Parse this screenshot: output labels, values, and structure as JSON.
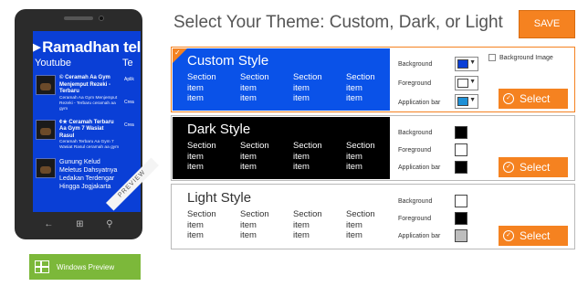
{
  "heading": "Select Your Theme: Custom, Dark, or Light",
  "save_label": "SAVE",
  "preview": {
    "title": "Ramadhan telah",
    "subtitle": "Youtube",
    "subtitle2": "Te",
    "feed": [
      {
        "title": "© Ceramah Aa Gym Menjemput Rezeki - Terbaru",
        "snippet": "Ceramah Aa Gym Menjemput Rezeki - Terbaru ceramah aa gym"
      },
      {
        "title": "¢★ Ceramah Terbaru Aa Gym 7 Wasiat Rasul",
        "snippet": "Ceramah Terbaru Aa Gym 7 Wasiat Rasul ceramah aa gym"
      },
      {
        "title": "Gunung Kelud Meletus Dahsyatnya Ledakan Terdengar Hingga Jogjakarta",
        "snippet": ""
      }
    ],
    "side_col": [
      "Aplik",
      "Crea",
      "Crea"
    ],
    "ribbon": "PREVIEW"
  },
  "windows_preview_label": "Windows Preview",
  "themes": [
    {
      "name": "Custom Style",
      "selected": true,
      "bg_color": "#0a52e8",
      "text_color": "#ffffff",
      "sections": [
        [
          "Section",
          "item",
          "item"
        ],
        [
          "Section",
          "item",
          "item"
        ],
        [
          "Section",
          "item",
          "item"
        ],
        [
          "Section",
          "item",
          "item"
        ]
      ],
      "props": [
        {
          "label": "Background",
          "color": "#0a3fd6"
        },
        {
          "label": "Foreground",
          "color": "#ffffff"
        },
        {
          "label": "Application bar",
          "color": "#1e90d6"
        }
      ],
      "background_image_label": "Background Image",
      "select_label": "Select"
    },
    {
      "name": "Dark Style",
      "selected": false,
      "bg_color": "#000000",
      "text_color": "#ffffff",
      "sections": [
        [
          "Section",
          "item",
          "item"
        ],
        [
          "Section",
          "item",
          "item"
        ],
        [
          "Section",
          "item",
          "item"
        ],
        [
          "Section",
          "item",
          "item"
        ]
      ],
      "props": [
        {
          "label": "Background",
          "color": "#000000"
        },
        {
          "label": "Foreground",
          "color": "#ffffff"
        },
        {
          "label": "Application bar",
          "color": "#000000"
        }
      ],
      "select_label": "Select"
    },
    {
      "name": "Light Style",
      "selected": false,
      "bg_color": "#ffffff",
      "text_color": "#333333",
      "sections": [
        [
          "Section",
          "item",
          "item"
        ],
        [
          "Section",
          "item",
          "item"
        ],
        [
          "Section",
          "item",
          "item"
        ],
        [
          "Section",
          "item",
          "item"
        ]
      ],
      "props": [
        {
          "label": "Background",
          "color": "#ffffff"
        },
        {
          "label": "Foreground",
          "color": "#000000"
        },
        {
          "label": "Application bar",
          "color": "#bdbdbd"
        }
      ],
      "select_label": "Select"
    }
  ],
  "colors": {
    "accent": "#f58220",
    "windows_green": "#7cb83a"
  }
}
